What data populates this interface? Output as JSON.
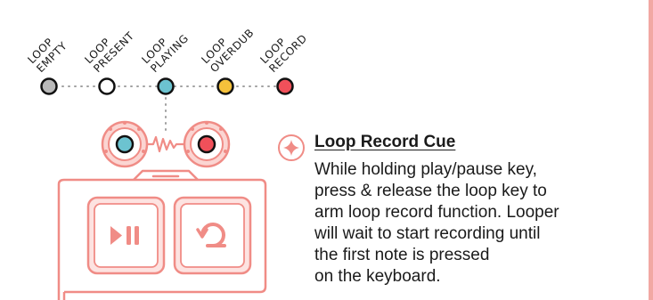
{
  "loop_states": [
    {
      "line1": "LOOP",
      "line2": "EMPTY",
      "color": "#b9b9b9"
    },
    {
      "line1": "LOOP",
      "line2": "PRESENT",
      "color": "#ffffff"
    },
    {
      "line1": "LOOP",
      "line2": "PLAYING",
      "color": "#6cc3d0"
    },
    {
      "line1": "LOOP",
      "line2": "OVERDUB",
      "color": "#f5c13b"
    },
    {
      "line1": "LOOP",
      "line2": "RECORD",
      "color": "#f0505a"
    }
  ],
  "knobs": {
    "left_color": "#6cc3d0",
    "right_color": "#f0505a"
  },
  "device": {
    "outline_color": "#f08c86",
    "buttons": [
      {
        "icon": "play-pause-icon",
        "glyph": "▶II"
      },
      {
        "icon": "loop-icon",
        "glyph": ""
      }
    ]
  },
  "info": {
    "icon": "sparkle-icon",
    "title": "Loop Record Cue",
    "body_lines": [
      "While holding play/pause key,",
      "press & release the loop key to",
      "arm loop record function. Looper",
      "will wait to start recording until",
      "the first note is pressed",
      "on the keyboard."
    ]
  },
  "accent_color": "#f2a8a3"
}
